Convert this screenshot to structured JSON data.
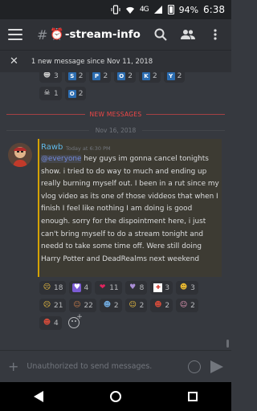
{
  "status": {
    "network": "4G",
    "battery": "94%",
    "time": "6:38"
  },
  "header": {
    "channel_hash": "#",
    "channel_emoji": "⏰",
    "channel_name": "-stream-info"
  },
  "new_banner": {
    "text": "1 new message since Nov 11, 2018"
  },
  "prev_reactions": {
    "row1": [
      {
        "emoji": "skull-face",
        "glyph": "☻",
        "count": "3"
      },
      {
        "emoji": "letter-s",
        "glyph": "S",
        "count": "2"
      },
      {
        "emoji": "letter-p",
        "glyph": "P",
        "count": "2"
      },
      {
        "emoji": "letter-o",
        "glyph": "O",
        "count": "2"
      },
      {
        "emoji": "letter-k",
        "glyph": "K",
        "count": "2"
      },
      {
        "emoji": "letter-y",
        "glyph": "Y",
        "count": "2"
      }
    ],
    "row2": [
      {
        "emoji": "skull",
        "glyph": "☠",
        "count": "1"
      },
      {
        "emoji": "letter-o",
        "glyph": "O",
        "count": "2"
      }
    ]
  },
  "divider": {
    "label": "NEW MESSAGES"
  },
  "date_sep": {
    "label": "Nov 16, 2018"
  },
  "message": {
    "author": "Rawb",
    "timestamp": "Today at 6:30 PM",
    "mention": "@everyone",
    "text": " hey guys im gonna cancel tonights show. i tried to do way to much and ending up really burning myself out. I been in a rut since my vlog video as its one of those viddeos that when I finish I feel like nothing I am doing is good enough. sorry for the dispointment here, i just can't bring myself to do a stream tonight and needd to take some time off. Were still doing Harry Potter and DeadRealms next weekend"
  },
  "reactions": {
    "row1": [
      {
        "emoji": "pensive",
        "glyph": "☹",
        "count": "18"
      },
      {
        "emoji": "purple-heart-box",
        "glyph": "♥",
        "count": "4"
      },
      {
        "emoji": "red-heart",
        "glyph": "❤",
        "count": "11"
      },
      {
        "emoji": "purple-heart",
        "glyph": "♥",
        "count": "8"
      },
      {
        "emoji": "canada-flag",
        "glyph": "✚",
        "count": "3"
      },
      {
        "emoji": "gold-face",
        "glyph": "☻",
        "count": "3"
      }
    ],
    "row2": [
      {
        "emoji": "sad-face",
        "glyph": "☹",
        "count": "21"
      },
      {
        "emoji": "character",
        "glyph": "☺",
        "count": "22"
      },
      {
        "emoji": "face",
        "glyph": "☻",
        "count": "2"
      },
      {
        "emoji": "kiss-face",
        "glyph": "☺",
        "count": "2"
      },
      {
        "emoji": "devil",
        "glyph": "☻",
        "count": "2"
      },
      {
        "emoji": "pink-face",
        "glyph": "☺",
        "count": "2"
      }
    ],
    "row3": [
      {
        "emoji": "character-2",
        "glyph": "☻",
        "count": "4"
      }
    ]
  },
  "composer": {
    "placeholder": "Unauthorized to send messages."
  },
  "colors": {
    "accent": "#7289da",
    "author": "#5fb8e8",
    "new_messages": "#f04747",
    "highlight_bar": "#d4a200"
  }
}
